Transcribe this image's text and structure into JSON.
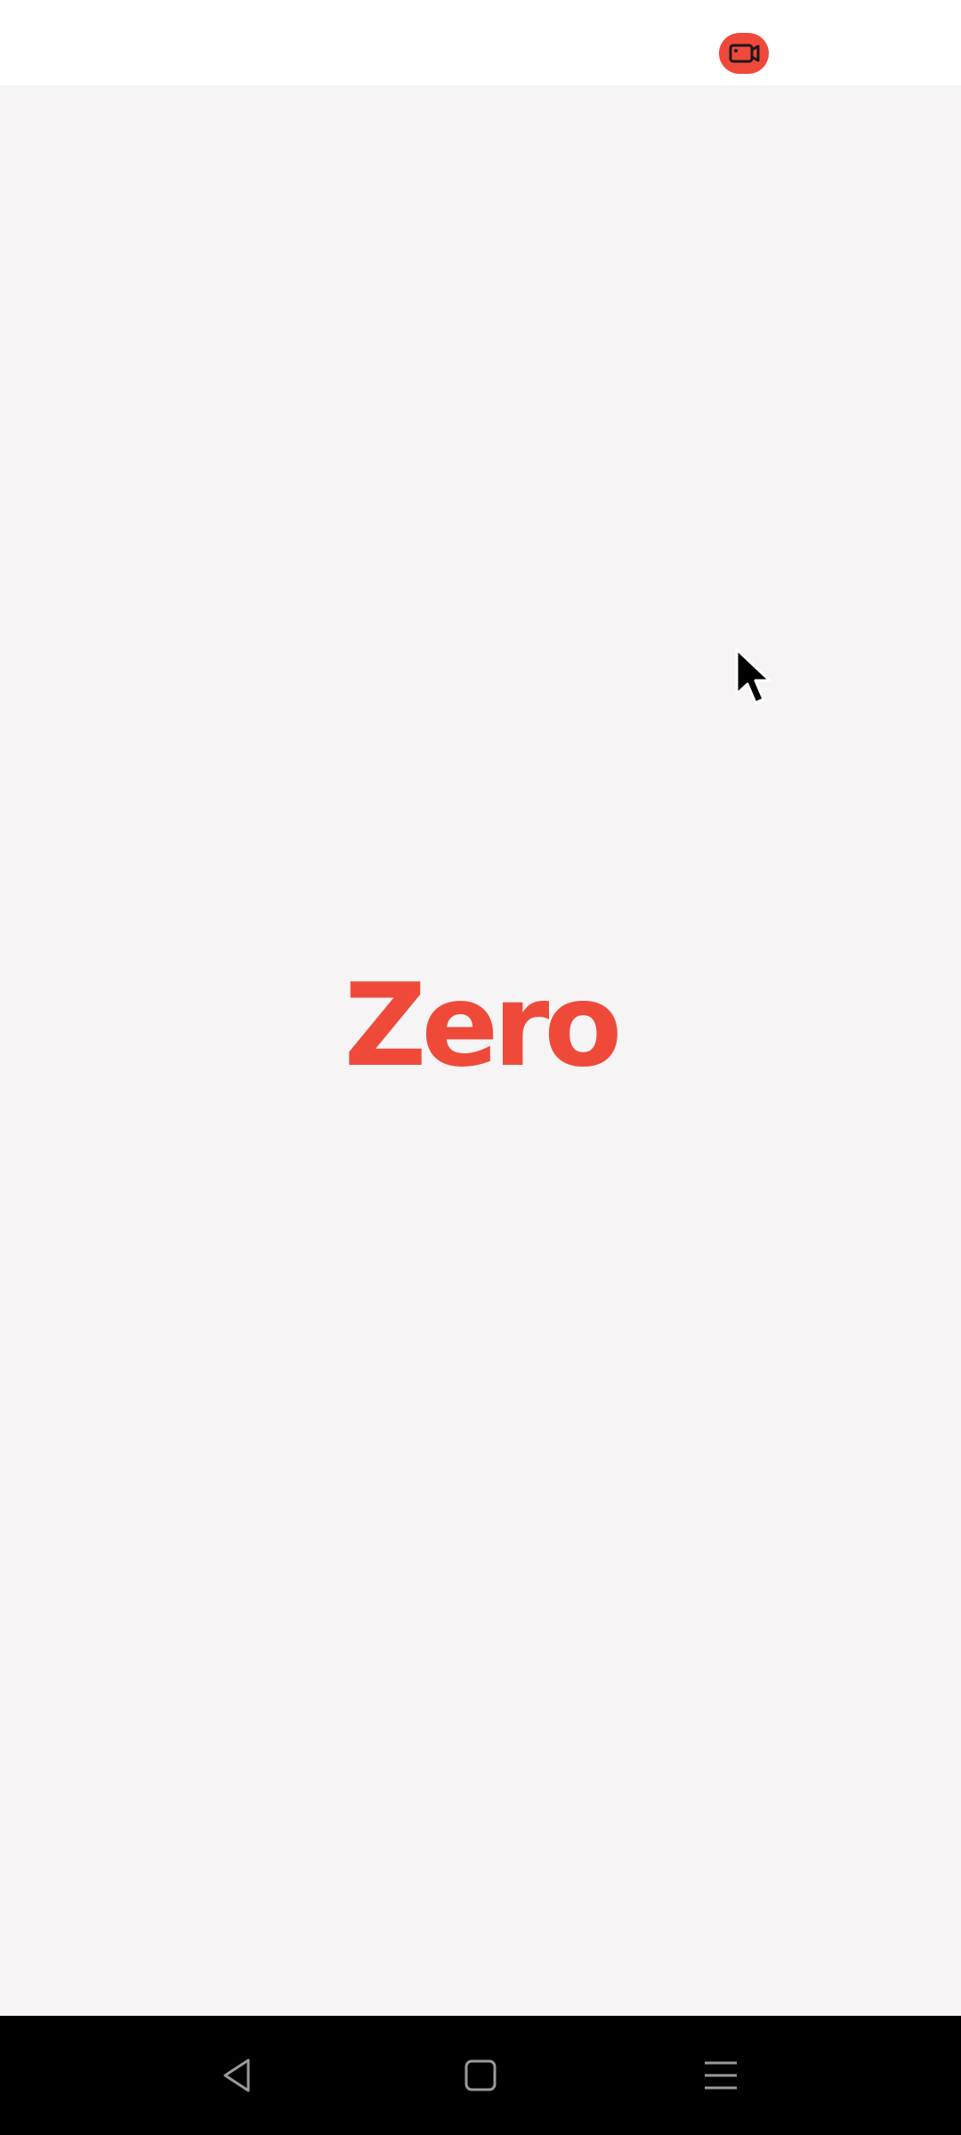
{
  "status_bar": {
    "record_icon": "video-camera-icon",
    "record_color": "#f0483a"
  },
  "splash": {
    "logo_text": "Zero",
    "logo_color": "#ef4a39",
    "background": "#f6f4f5"
  },
  "overlay": {
    "cursor_icon": "mouse-pointer-icon"
  },
  "nav_bar": {
    "back_icon": "back-triangle-icon",
    "home_icon": "home-square-icon",
    "menu_icon": "menu-lines-icon"
  }
}
